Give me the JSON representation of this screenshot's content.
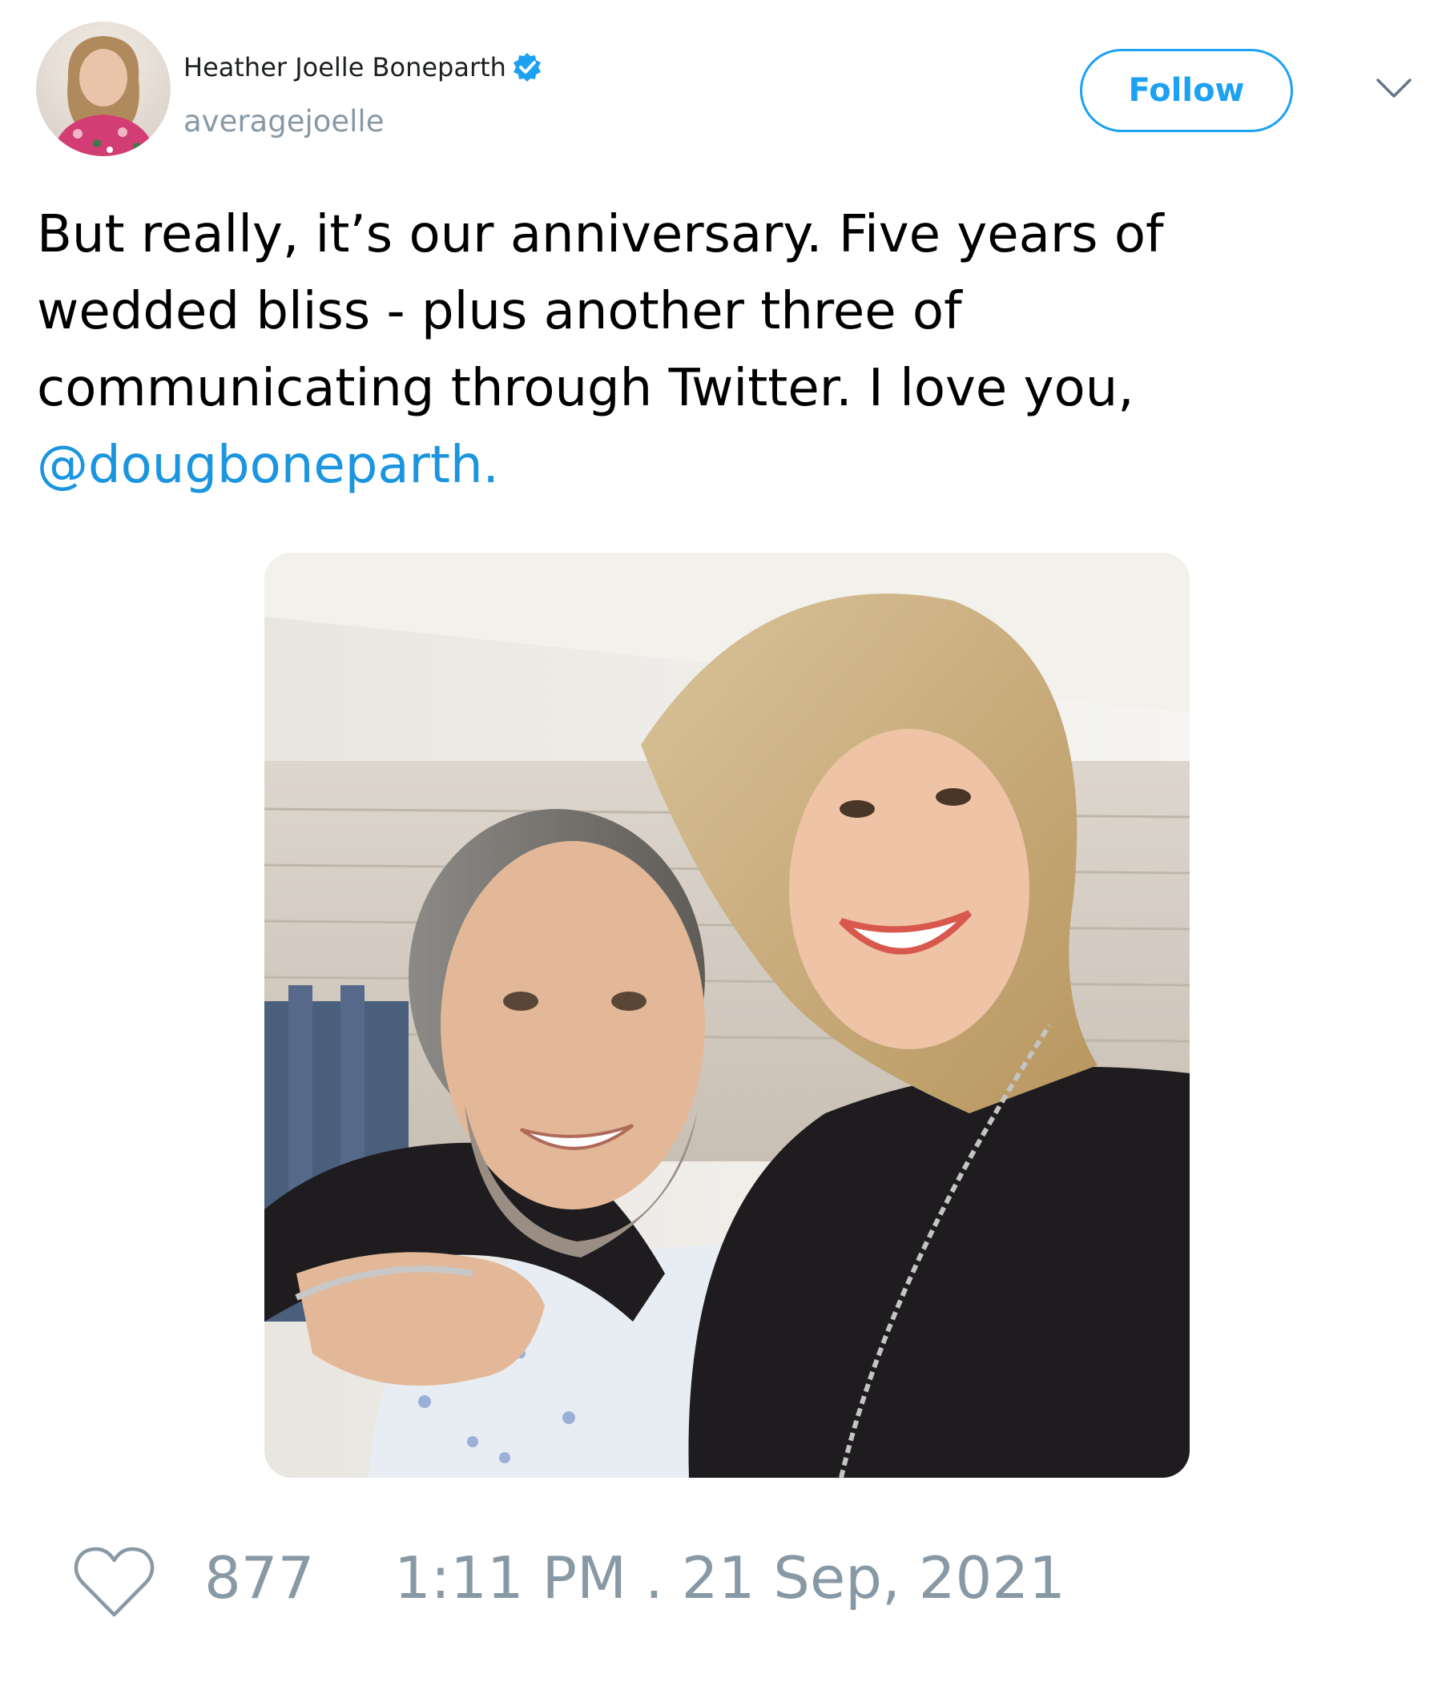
{
  "author": {
    "display_name": "Heather Joelle Boneparth",
    "handle": "averagejoelle",
    "verified": true
  },
  "header": {
    "follow_label": "Follow",
    "menu_icon": "chevron-down-icon"
  },
  "tweet": {
    "text": "But really, it’s our anniversary. Five years of wedded bliss - plus another three of communicating through Twitter. I love you, ",
    "mention": "@dougboneparth."
  },
  "footer": {
    "like_icon": "heart-icon",
    "like_count": "877",
    "timestamp": "1:11 PM . 21 Sep, 2021"
  },
  "colors": {
    "accent": "#1da1f2",
    "link": "#1b95e0",
    "muted": "#8899a6",
    "text": "#000000"
  }
}
